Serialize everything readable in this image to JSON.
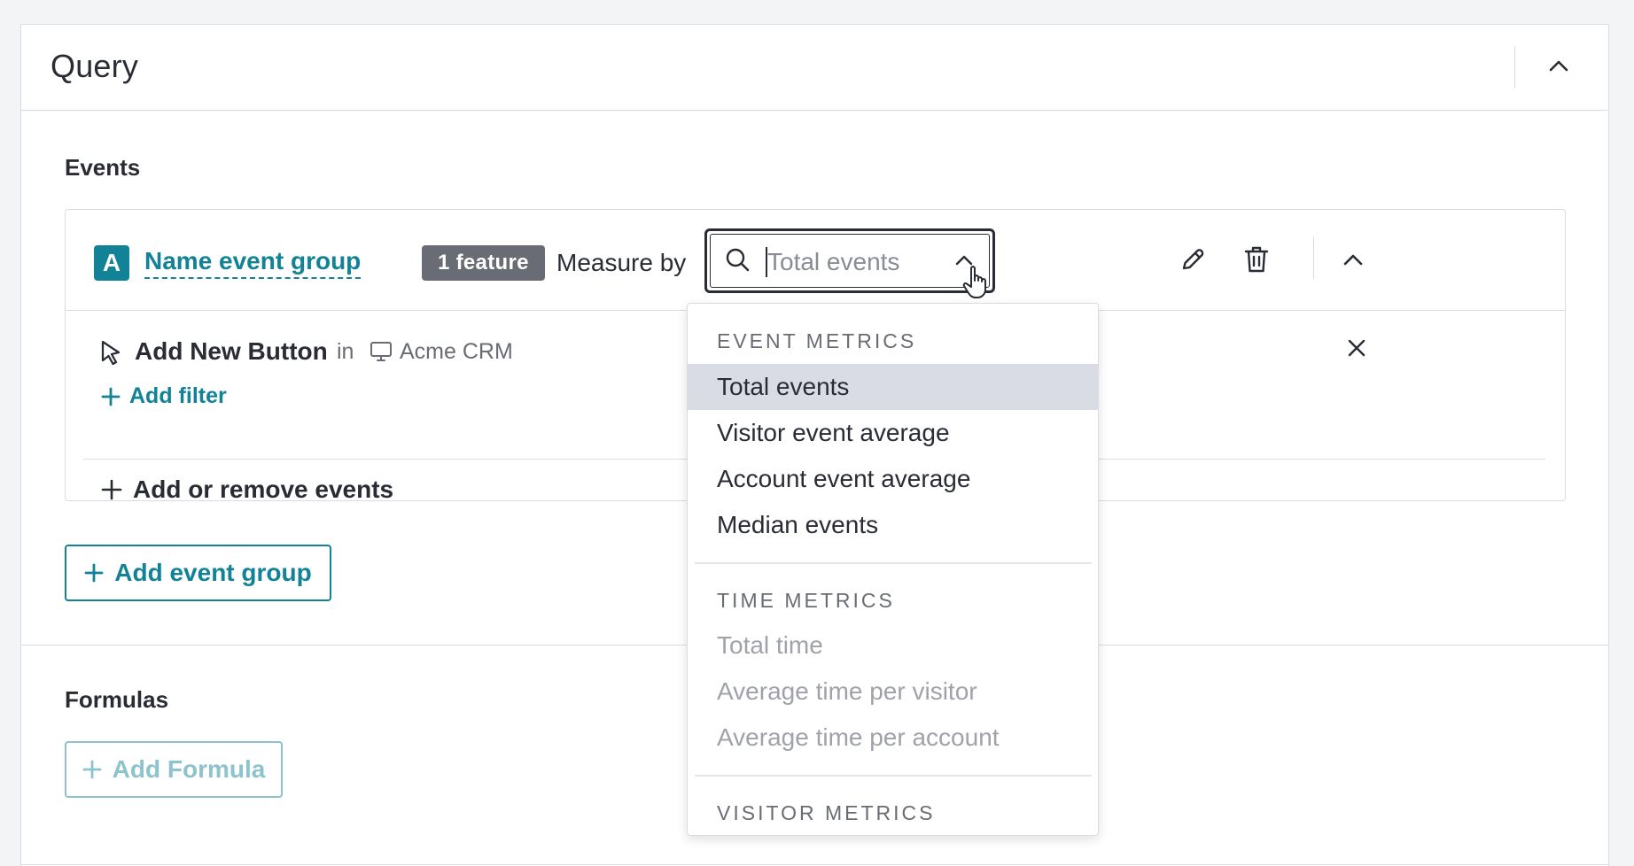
{
  "card": {
    "title": "Query"
  },
  "events_section": {
    "label": "Events",
    "group": {
      "badge": "A",
      "name": "Name event group",
      "feature_count": "1 feature",
      "measure_label": "Measure by",
      "measure_placeholder": "Total events"
    },
    "event_row": {
      "name": "Add New Button",
      "in_label": "in",
      "app": "Acme CRM",
      "add_filter": "Add filter"
    },
    "add_remove": "Add or remove events",
    "add_group_button": "Add event group"
  },
  "formulas_section": {
    "label": "Formulas",
    "add_formula_button": "Add Formula"
  },
  "dropdown": {
    "groups": [
      {
        "heading": "EVENT METRICS",
        "items": [
          "Total events",
          "Visitor event average",
          "Account event average",
          "Median events"
        ]
      },
      {
        "heading": "TIME METRICS",
        "items": [
          "Total time",
          "Average time per visitor",
          "Average time per account"
        ]
      },
      {
        "heading": "VISITOR METRICS",
        "items": []
      }
    ],
    "selected": "Total events"
  },
  "colors": {
    "accent": "#128297",
    "text": "#2a2c35",
    "muted": "#6a6c75",
    "border": "#dadce5",
    "selected_bg": "#dadce5",
    "pill_bg": "#6a6c75"
  },
  "icons": [
    "chevron-up-icon",
    "search-icon",
    "pencil-icon",
    "trash-icon",
    "cursor-pointer-icon",
    "monitor-icon",
    "close-icon",
    "plus-icon",
    "hand-cursor-icon"
  ]
}
